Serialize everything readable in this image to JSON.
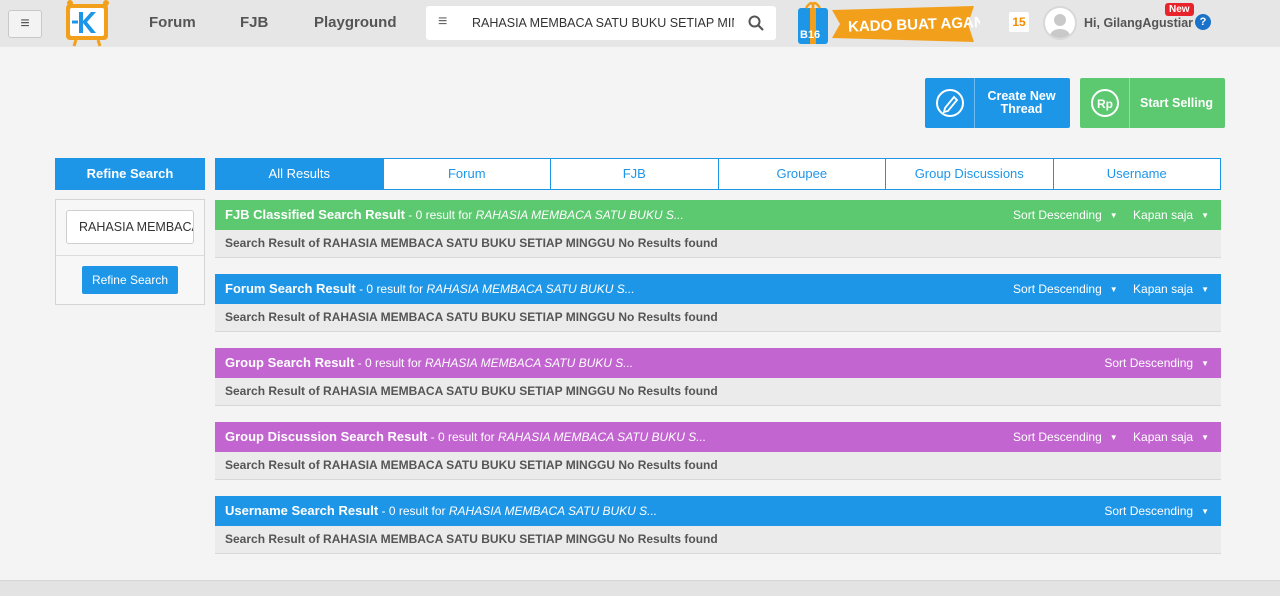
{
  "nav": {
    "menu_icon": "hamburger-icon",
    "links": [
      "Forum",
      "FJB",
      "Playground"
    ],
    "search": {
      "value": "RAHASIA MEMBACA SATU BUKU SETIAP MIN"
    },
    "promo": {
      "badge": "B16",
      "text": "KADO BUAT AGAN"
    },
    "notifications": "15",
    "user_greeting": "Hi, GilangAgustiar",
    "new_badge": "New",
    "help_icon": "question-icon"
  },
  "actions": {
    "create_thread": "Create New Thread",
    "start_selling": "Start Selling",
    "rp_icon_text": "Rp"
  },
  "refine": {
    "title": "Refine Search",
    "input_value": "RAHASIA MEMBACA SATU BUKU SETIAP MINGGU",
    "button": "Refine Search"
  },
  "tabs": [
    "All Results",
    "Forum",
    "FJB",
    "Groupee",
    "Group Discussions",
    "Username"
  ],
  "sections": [
    {
      "title": "FJB Classified Search Result",
      "count": " - 0 result for ",
      "query": "RAHASIA MEMBACA SATU BUKU S...",
      "sort": "Sort Descending",
      "time": "Kapan saja",
      "body": "Search Result of RAHASIA MEMBACA SATU BUKU SETIAP MINGGU No Results found",
      "color": "#5cc870"
    },
    {
      "title": "Forum Search Result",
      "count": " - 0 result for ",
      "query": "RAHASIA MEMBACA SATU BUKU S...",
      "sort": "Sort Descending",
      "time": "Kapan saja",
      "body": "Search Result of RAHASIA MEMBACA SATU BUKU SETIAP MINGGU No Results found",
      "color": "#1e96e8"
    },
    {
      "title": "Group Search Result",
      "count": " - 0 result for ",
      "query": "RAHASIA MEMBACA SATU BUKU S...",
      "sort": "Sort Descending",
      "time": null,
      "body": "Search Result of RAHASIA MEMBACA SATU BUKU SETIAP MINGGU No Results found",
      "color": "#c365d1"
    },
    {
      "title": "Group Discussion Search Result",
      "count": " - 0 result for ",
      "query": "RAHASIA MEMBACA SATU BUKU S...",
      "sort": "Sort Descending",
      "time": "Kapan saja",
      "body": "Search Result of RAHASIA MEMBACA SATU BUKU SETIAP MINGGU No Results found",
      "color": "#c365d1"
    },
    {
      "title": "Username Search Result",
      "count": " - 0 result for ",
      "query": "RAHASIA MEMBACA SATU BUKU S...",
      "sort": "Sort Descending",
      "time": null,
      "body": "Search Result of RAHASIA MEMBACA SATU BUKU SETIAP MINGGU No Results found",
      "color": "#1e96e8"
    }
  ]
}
